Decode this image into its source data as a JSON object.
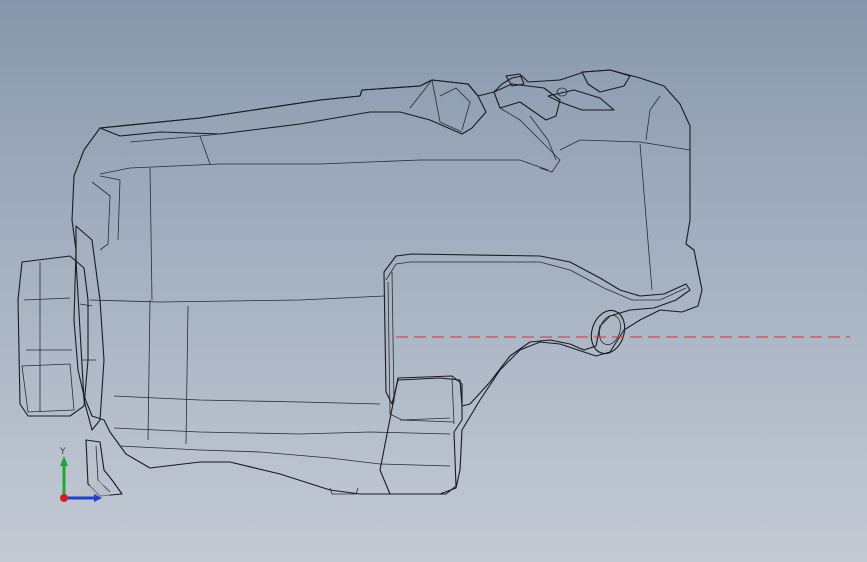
{
  "viewport": {
    "background_top": "#8797ab",
    "background_bottom": "#c3cad4",
    "model_face_color": "#ffffff",
    "model_shade_color": "#8e8cf0",
    "edge_color": "#1a1a22",
    "reference_line_color": "#e0302a"
  },
  "triad": {
    "y_label": "Y",
    "x_axis_color": "#1f3fd8",
    "y_axis_color": "#1fa53a",
    "origin_color": "#d81f1f",
    "icons": [
      "axis-triad-icon"
    ]
  }
}
